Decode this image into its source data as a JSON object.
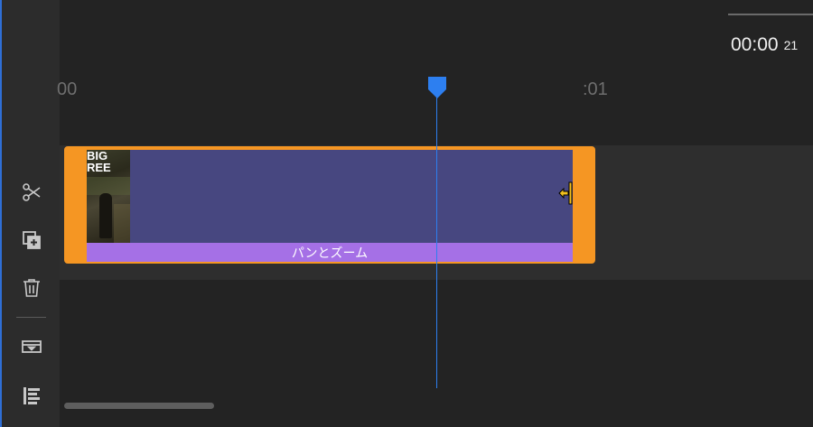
{
  "header": {
    "timecode": "00:00",
    "timecode_frames": "21"
  },
  "ruler": {
    "start_label": "00",
    "mark_label": ":01"
  },
  "clip": {
    "thumbnail_title_line1": "BIG",
    "thumbnail_title_line2": "REE",
    "effect_label": "パンとズーム",
    "color_border": "#f59623",
    "color_body": "#474780",
    "color_effect": "#a570e6"
  },
  "toolbar": {
    "tools": [
      {
        "icon": "scissors-icon"
      },
      {
        "icon": "duplicate-add-icon"
      },
      {
        "icon": "trash-icon"
      },
      {
        "icon": "track-collapse-icon"
      },
      {
        "icon": "align-left-icon"
      }
    ]
  },
  "colors": {
    "playhead": "#2d7ff0",
    "background": "#232323",
    "rail": "#2c2c2c"
  }
}
